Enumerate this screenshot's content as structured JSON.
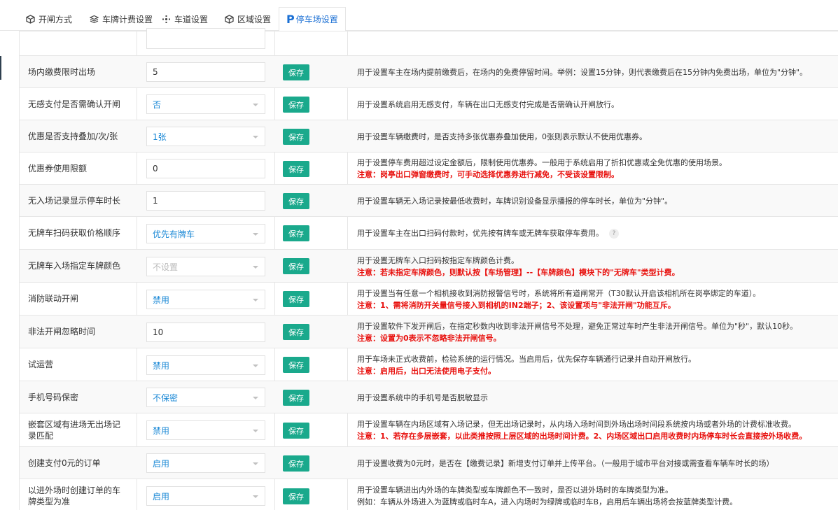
{
  "tabs": [
    {
      "label": "开闸方式",
      "icon": "cube-icon"
    },
    {
      "label": "车牌计费设置",
      "icon": "layers-icon"
    },
    {
      "label": "车道设置",
      "icon": "lane-icon"
    },
    {
      "label": "区域设置",
      "icon": "cube-icon"
    },
    {
      "label": "停车场设置",
      "icon": "parking-icon",
      "active": true
    }
  ],
  "save_label": "保存",
  "rows": [
    {
      "label": "场内缴费限时出场",
      "type": "input",
      "value": "5",
      "desc": "用于设置车主在场内提前缴费后，在场内的免费停留时间。举例：设置15分钟，则代表缴费后在15分钟内免费出场，单位为\"分钟\"。",
      "note": ""
    },
    {
      "label": "无感支付是否需确认开闸",
      "type": "select",
      "value": "否",
      "desc": "用于设置系统启用无感支付，车辆在出口无感支付完成是否需确认开闸放行。",
      "note": ""
    },
    {
      "label": "优惠是否支持叠加/次/张",
      "type": "select",
      "value": "1张",
      "desc": "用于设置车辆缴费时，是否支持多张优惠券叠加使用，0张则表示默认不使用优惠券。",
      "note": ""
    },
    {
      "label": "优惠券使用限额",
      "type": "input",
      "value": "0",
      "desc": "用于设置停车费用超过设定金额后，限制使用优惠券。一般用于系统启用了折扣优惠或全免优惠的使用场景。",
      "note": "注意：岗亭出口弹窗缴费时，可手动选择优惠券进行减免，不受该设置限制。"
    },
    {
      "label": "无入场记录显示停车时长",
      "type": "input",
      "value": "1",
      "desc": "用于设置车辆无入场记录按最低收费时，车牌识别设备显示播报的停车时长，单位为\"分钟\"。",
      "note": ""
    },
    {
      "label": "无牌车扫码获取价格顺序",
      "type": "select",
      "value": "优先有牌车",
      "desc": "用于设置车主在出口扫码付款时，优先按有牌车或无牌车获取停车费用。",
      "note": "",
      "help": "?"
    },
    {
      "label": "无牌车入场指定车牌颜色",
      "type": "select",
      "value": "",
      "placeholder": "不设置",
      "desc": "用于设置无牌车入口扫码按指定车牌颜色计费。",
      "note": "注意：若未指定车牌颜色，则默认按【车场管理】--【车牌颜色】模块下的\"无牌车\"类型计费。"
    },
    {
      "label": "消防联动开闸",
      "type": "select",
      "value": "禁用",
      "desc": "用于设置当有任意一个相机接收到消防报警信号时，系统将所有道闸常开（T30默认开启该相机所在岗亭绑定的车道）。",
      "note": "注意：1、需将消防开关量信号接入到相机的IN2端子；2、该设置项与\"非法开闸\"功能互斥。"
    },
    {
      "label": "非法开闸忽略时间",
      "type": "input",
      "value": "10",
      "desc": "用于设置软件下发开闸后，在指定秒数内收到非法开闸信号不处理，避免正常过车时产生非法开闸信号。单位为\"秒\"，默认10秒。",
      "note": "注意：设置为0表示不忽略非法开闸信号。"
    },
    {
      "label": "试运营",
      "type": "select",
      "value": "禁用",
      "desc": "用于车场未正式收费前，检验系统的运行情况。当启用后，优先保存车辆通行记录并自动开闸放行。",
      "note": "注意：启用后，出口无法使用电子支付。"
    },
    {
      "label": "手机号码保密",
      "type": "select",
      "value": "不保密",
      "desc": "用于设置系统中的手机号是否脱敏显示",
      "note": ""
    },
    {
      "label": "嵌套区域有进场无出场记录匹配",
      "type": "select",
      "value": "禁用",
      "desc": "用于设置车辆在内场区域有入场记录，但无出场记录时，从内场入场时间到外场出场时间段系统按内场或者外场的计费标准收费。",
      "note": "注意：1、若存在多层嵌套，以此类推按照上层区域的出场时间计费。2、内场区域出口启用收费时内场停车时长会直接按外场收费。"
    },
    {
      "label": "创建支付0元的订单",
      "type": "select",
      "value": "启用",
      "desc": "用于设置收费为0元时，是否在【缴费记录】新增支付订单并上传平台。（一般用于城市平台对接或需查看车辆车时长的场）",
      "note": ""
    },
    {
      "label": "以进外场时创建订单的车牌类型为准",
      "type": "select",
      "value": "启用",
      "desc": "用于设置车辆进出内外场的车牌类型或车牌颜色不一致时，是否以进外场时的车牌类型为准。",
      "note": "",
      "extra": "例如：车辆从外场进入为蓝牌或临时车A，进入内场时为绿牌或临时车B，启用后车辆出场将会按蓝牌类型计费。"
    }
  ]
}
